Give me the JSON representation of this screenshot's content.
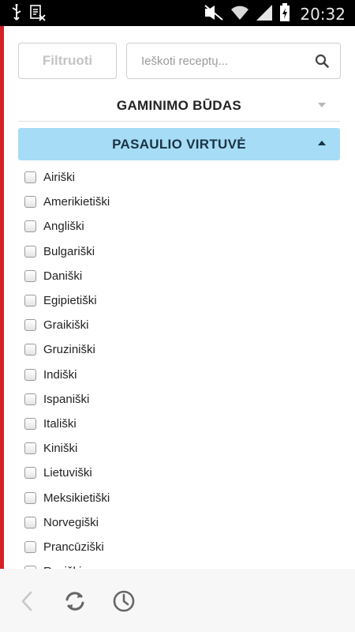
{
  "status_bar": {
    "time": "20:32",
    "icons": [
      "usb-icon",
      "notification-icon",
      "mute-icon",
      "wifi-icon",
      "signal-icon",
      "battery-charging-icon"
    ]
  },
  "toolbar": {
    "filter_label": "Filtruoti",
    "search_placeholder": "Ieškoti receptų...",
    "search_value": ""
  },
  "sections": {
    "cooking_method": "GAMINIMO BŪDAS",
    "world_cuisine": "PASAULIO VIRTUVĖ"
  },
  "cuisines": [
    {
      "label": "Airiški",
      "checked": false
    },
    {
      "label": "Amerikietiški",
      "checked": false
    },
    {
      "label": "Angliški",
      "checked": false
    },
    {
      "label": "Bulgariški",
      "checked": false
    },
    {
      "label": "Daniški",
      "checked": false
    },
    {
      "label": "Egipietiški",
      "checked": false
    },
    {
      "label": "Graikiški",
      "checked": false
    },
    {
      "label": "Gruziniški",
      "checked": false
    },
    {
      "label": "Indiški",
      "checked": false
    },
    {
      "label": "Ispaniški",
      "checked": false
    },
    {
      "label": "Itališki",
      "checked": false
    },
    {
      "label": "Kiniški",
      "checked": false
    },
    {
      "label": "Lietuviški",
      "checked": false
    },
    {
      "label": "Meksikietiški",
      "checked": false
    },
    {
      "label": "Norvegiški",
      "checked": false
    },
    {
      "label": "Prancūziški",
      "checked": false
    },
    {
      "label": "Rusiški",
      "checked": false
    }
  ],
  "bottom_nav": {
    "icons": [
      "back-icon",
      "refresh-icon",
      "history-icon"
    ]
  },
  "colors": {
    "accent_red": "#d61f26",
    "section_active_bg": "#a6dcf5"
  }
}
